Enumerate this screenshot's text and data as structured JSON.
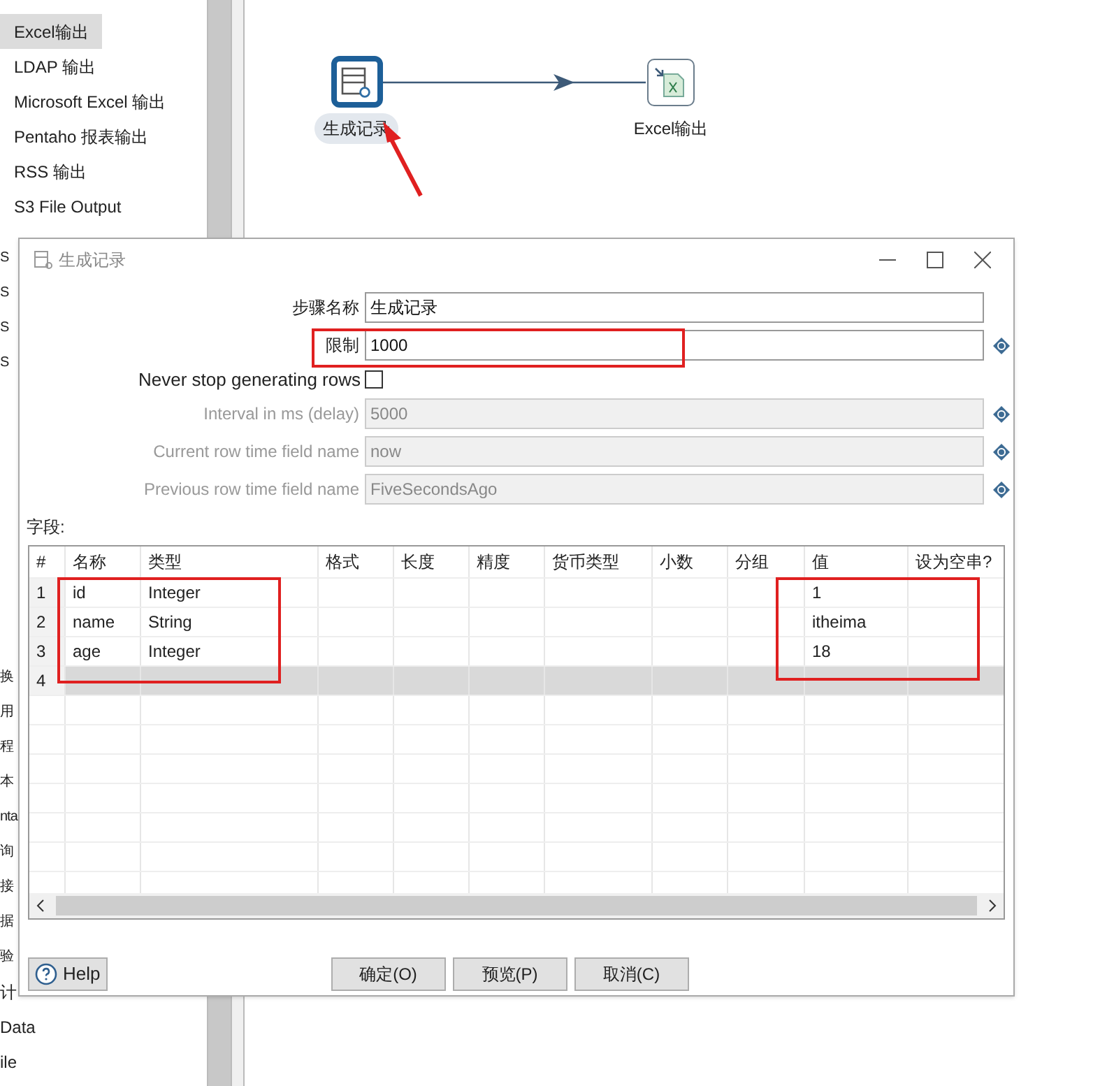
{
  "sidebar": {
    "items": [
      {
        "label": "Excel输出",
        "selected": true
      },
      {
        "label": "LDAP 输出",
        "selected": false
      },
      {
        "label": "Microsoft Excel 输出",
        "selected": false
      },
      {
        "label": "Pentaho 报表输出",
        "selected": false
      },
      {
        "label": "RSS 输出",
        "selected": false
      },
      {
        "label": "S3 File Output",
        "selected": false
      }
    ],
    "partial_items_upper": [
      "S",
      "S",
      "S",
      "S"
    ],
    "partial_items_lower": [
      "换",
      "用",
      "程",
      "本",
      "nta",
      "询",
      "接",
      "据",
      "验"
    ],
    "items_below": [
      "计",
      "Data",
      "ile"
    ]
  },
  "canvas": {
    "steps": [
      {
        "kind": "generator",
        "label": "生成记录",
        "selected": true
      },
      {
        "kind": "excel",
        "label": "Excel输出",
        "selected": false
      }
    ]
  },
  "dialog": {
    "title": "生成记录",
    "fields": [
      {
        "kind": "text",
        "label": "步骤名称",
        "value": "生成记录",
        "disabled": false,
        "variable": false
      },
      {
        "kind": "text",
        "label": "限制",
        "value": "1000",
        "disabled": false,
        "variable": true
      },
      {
        "kind": "checkbox",
        "label": "Never stop generating rows",
        "checked": false
      },
      {
        "kind": "text",
        "label": "Interval in ms (delay)",
        "value": "5000",
        "disabled": true,
        "variable": true
      },
      {
        "kind": "text",
        "label": "Current row time field name",
        "value": "now",
        "disabled": true,
        "variable": true
      },
      {
        "kind": "text",
        "label": "Previous row time field name",
        "value": "FiveSecondsAgo",
        "disabled": true,
        "variable": true
      }
    ],
    "table_label": "字段:",
    "table": {
      "columns": [
        "#",
        "名称",
        "类型",
        "格式",
        "长度",
        "精度",
        "货币类型",
        "小数",
        "分组",
        "值",
        "设为空串?"
      ],
      "rows": [
        {
          "selected": false,
          "cells": [
            "1",
            "id",
            "Integer",
            "",
            "",
            "",
            "",
            "",
            "",
            "1",
            ""
          ]
        },
        {
          "selected": false,
          "cells": [
            "2",
            "name",
            "String",
            "",
            "",
            "",
            "",
            "",
            "",
            "itheima",
            ""
          ]
        },
        {
          "selected": false,
          "cells": [
            "3",
            "age",
            "Integer",
            "",
            "",
            "",
            "",
            "",
            "",
            "18",
            ""
          ]
        },
        {
          "selected": true,
          "cells": [
            "4",
            "",
            "",
            "",
            "",
            "",
            "",
            "",
            "",
            "",
            ""
          ]
        }
      ]
    },
    "buttons": [
      {
        "kind": "help",
        "label": "Help"
      },
      {
        "kind": "action",
        "label": "确定(O)"
      },
      {
        "kind": "action",
        "label": "预览(P)"
      },
      {
        "kind": "action",
        "label": "取消(C)"
      }
    ]
  }
}
